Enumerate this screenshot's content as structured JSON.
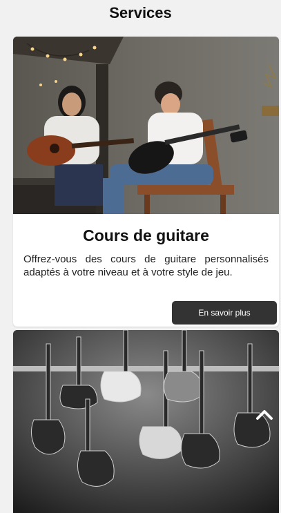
{
  "page": {
    "title": "Services"
  },
  "cards": [
    {
      "title": "Cours de guitare",
      "description": "Offrez-vous des cours de guitare personnalisés adaptés à votre niveau et à votre style de jeu.",
      "button_label": "En savoir plus",
      "image_alt": "guitar-lesson-photo"
    },
    {
      "image_alt": "bass-guitars-wall-photo"
    }
  ],
  "scroll_top": {
    "icon": "chevron-up-icon"
  },
  "colors": {
    "background": "#f1f1f1",
    "card": "#ffffff",
    "button": "#333333",
    "button_text": "#ffffff"
  }
}
